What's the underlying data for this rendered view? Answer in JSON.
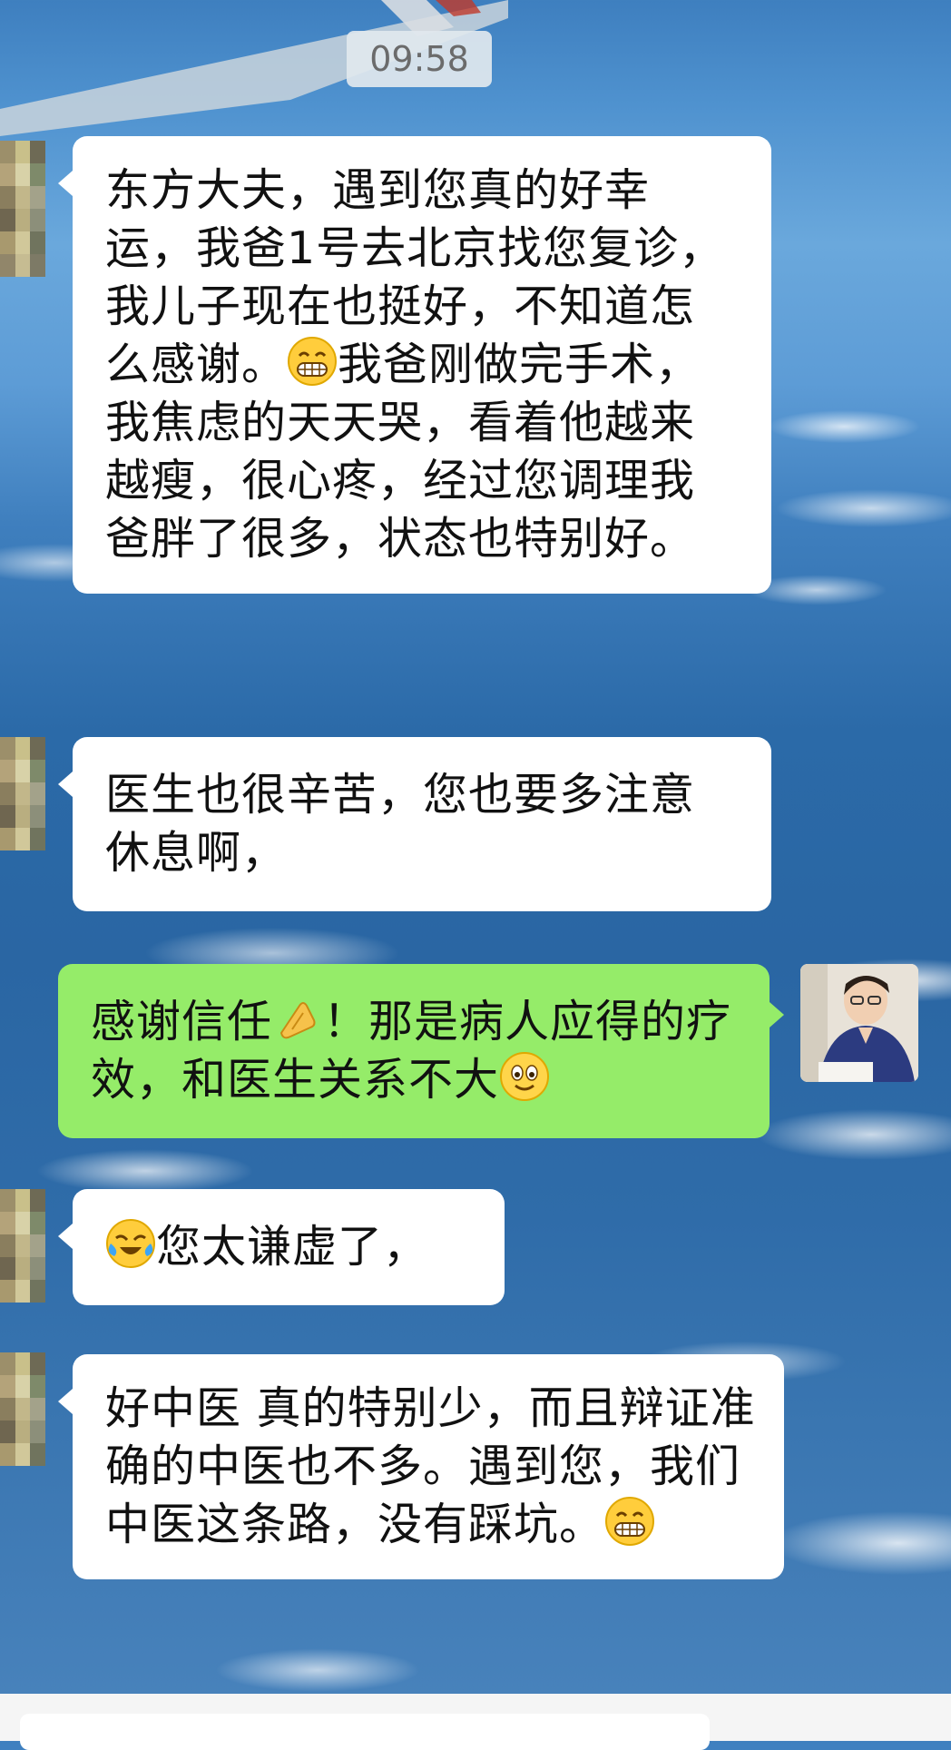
{
  "timestamp": "09:58",
  "messages": [
    {
      "direction": "incoming",
      "text": "东方大夫，遇到您真的好幸运，我爸1号去北京找您复诊，我儿子现在也挺好，不知道怎么感谢。",
      "emoji": "grin-emoji",
      "text_after": "我爸刚做完手术，我焦虑的天天哭，看着他越来越瘦，很心疼，经过您调理我爸胖了很多，状态也特别好。"
    },
    {
      "direction": "incoming",
      "text": "医生也很辛苦，您也要多注意休息啊，"
    },
    {
      "direction": "outgoing",
      "text": "感谢信任",
      "emoji": "pray-emoji",
      "text_after": "！那是病人应得的疗效，和医生关系不大",
      "emoji2": "smile-emoji"
    },
    {
      "direction": "incoming",
      "emoji": "tears-of-joy-emoji",
      "text_after": "您太谦虚了，"
    },
    {
      "direction": "incoming",
      "text": "好中医 真的特别少，而且辩证准确的中医也不多。遇到您，我们中医这条路，没有踩坑。",
      "emoji": "grin-emoji"
    }
  ],
  "colors": {
    "incoming_bubble": "#ffffff",
    "outgoing_bubble": "#95ec69",
    "timestamp_bg": "#e1e8ee"
  }
}
